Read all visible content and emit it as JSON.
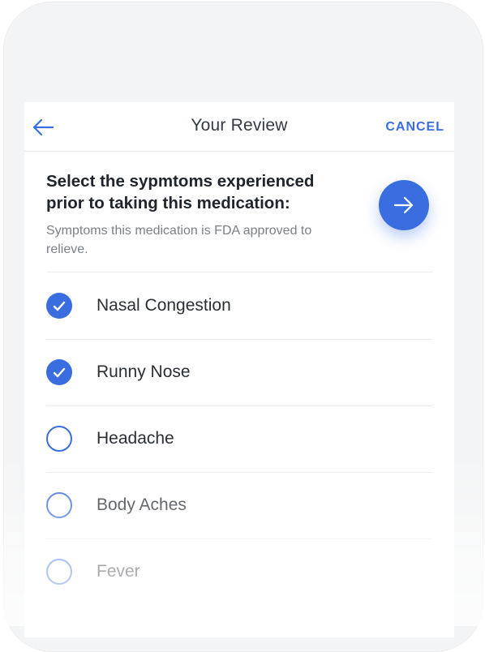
{
  "header": {
    "title": "Your Review",
    "cancel_label": "CANCEL"
  },
  "prompt": {
    "question": "Select the sypmtoms experienced prior to taking this medication:",
    "helper": "Symptoms this medication is FDA approved to relieve."
  },
  "symptoms": [
    {
      "label": "Nasal Congestion",
      "checked": true
    },
    {
      "label": "Runny Nose",
      "checked": true
    },
    {
      "label": "Headache",
      "checked": false
    },
    {
      "label": "Body Aches",
      "checked": false
    },
    {
      "label": "Fever",
      "checked": false
    }
  ],
  "colors": {
    "accent": "#3a6ee0",
    "title_text": "#333a44",
    "helper_text": "#7b8088"
  },
  "icons": {
    "back": "arrow-left-icon",
    "next": "arrow-right-icon",
    "checked": "checkmark-icon"
  }
}
